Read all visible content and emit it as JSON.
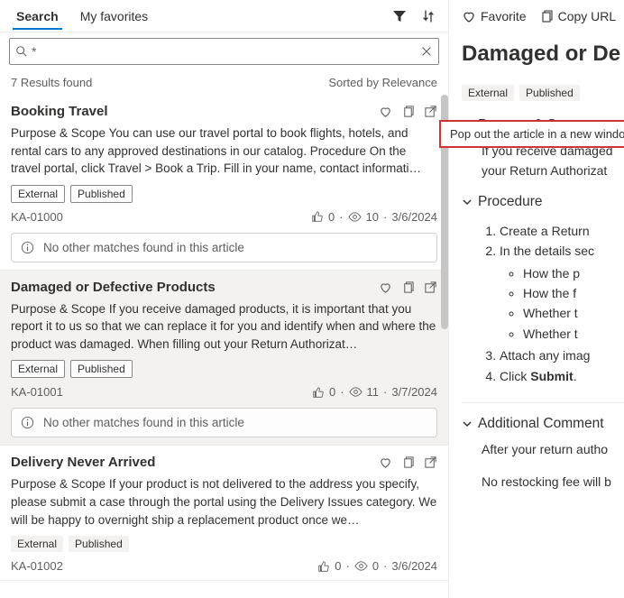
{
  "tabs": {
    "search": "Search",
    "favorites": "My favorites"
  },
  "search": {
    "value": "*",
    "results_count": "7 Results found",
    "sort_label": "Sorted by Relevance"
  },
  "results": [
    {
      "title": "Booking Travel",
      "snippet": "Purpose & Scope You can use our travel portal to book flights, hotels, and rental cars to any approved destinations in our catalog. Procedure On the travel portal, click Travel > Book a Trip. Fill in your name, contact informati…",
      "badges": [
        "External",
        "Published"
      ],
      "id": "KA-01000",
      "likes": "0",
      "views": "10",
      "date": "3/6/2024",
      "no_match": "No other matches found in this article",
      "badge_outlined": true,
      "selected": false
    },
    {
      "title": "Damaged or Defective Products",
      "snippet": "Purpose & Scope If you receive damaged products, it is important that you report it to us so that we can replace it for you and identify when and where the product was damaged. When filling out your Return Authorizat…",
      "badges": [
        "External",
        "Published"
      ],
      "id": "KA-01001",
      "likes": "0",
      "views": "11",
      "date": "3/7/2024",
      "no_match": "No other matches found in this article",
      "badge_outlined": true,
      "selected": true
    },
    {
      "title": "Delivery Never Arrived",
      "snippet": "Purpose & Scope If your product is not delivered to the address you specify, please submit a case through the portal using the Delivery Issues category. We will be happy to overnight ship a replacement product once we…",
      "badges": [
        "External",
        "Published"
      ],
      "id": "KA-01002",
      "likes": "0",
      "views": "0",
      "date": "3/6/2024",
      "no_match": "",
      "badge_outlined": false,
      "selected": false
    }
  ],
  "right": {
    "favorite": "Favorite",
    "copy_url": "Copy URL",
    "title": "Damaged or De",
    "badges": [
      "External",
      "Published"
    ],
    "tooltip": "Pop out the article in a new window",
    "sections": {
      "purpose_title": "Purpose & Scope",
      "purpose_body1": "If you receive damaged",
      "purpose_body2": "your Return Authorizat",
      "procedure_title": "Procedure",
      "proc_steps": [
        "Create a Return ",
        "In the details sec",
        "Attach any imag",
        "Click "
      ],
      "proc_submit": "Submit",
      "proc_sub": [
        "How the p",
        "How the f",
        "Whether t",
        "Whether t"
      ],
      "additional_title": "Additional Comment",
      "add1": "After your return autho",
      "add2": "No restocking fee will b"
    }
  }
}
